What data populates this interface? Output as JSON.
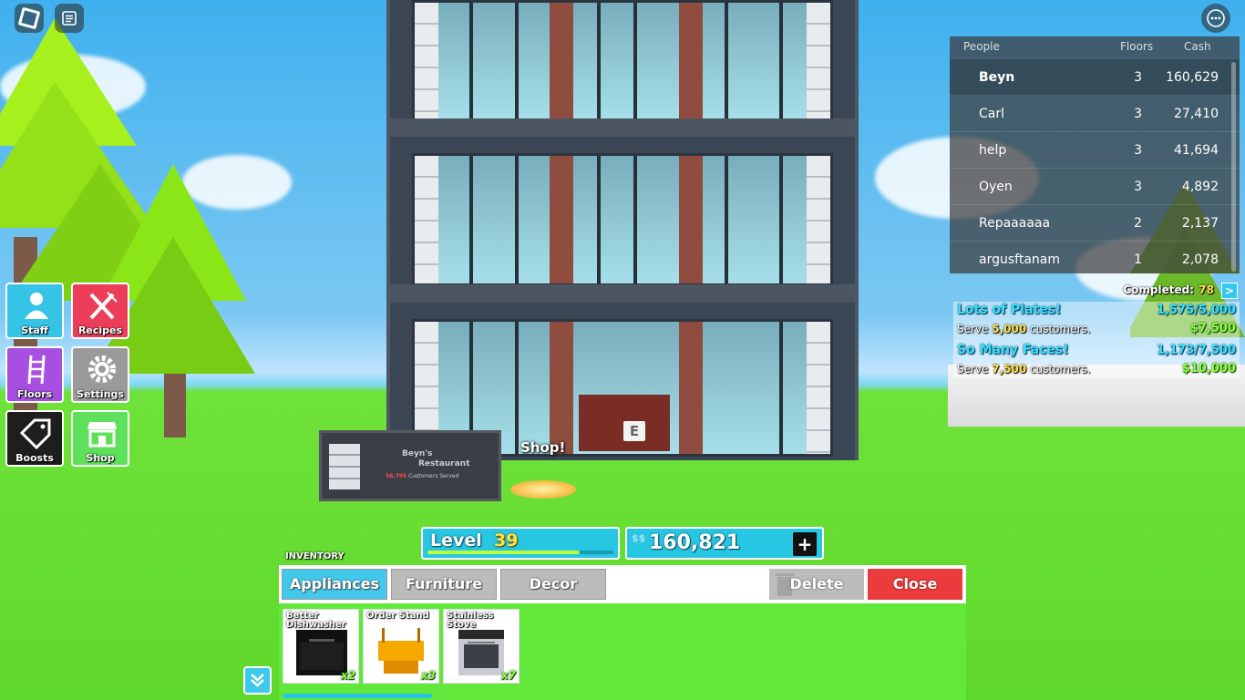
{
  "topbar": {
    "roblox_icon": "roblox-logo-icon",
    "chat_icon": "chat-icon",
    "more_icon": "more-options-icon"
  },
  "menu": {
    "staff": "Staff",
    "recipes": "Recipes",
    "floors": "Floors",
    "settings": "Settings",
    "boosts": "Boosts",
    "shop": "Shop"
  },
  "leaderboard": {
    "headers": {
      "people": "People",
      "floors": "Floors",
      "cash": "Cash"
    },
    "rows": [
      {
        "name": "Beyn",
        "floors": "3",
        "cash": "160,629"
      },
      {
        "name": "Carl",
        "floors": "3",
        "cash": "27,410"
      },
      {
        "name": "help",
        "floors": "3",
        "cash": "41,694"
      },
      {
        "name": "Oyen",
        "floors": "3",
        "cash": "4,892"
      },
      {
        "name": "Repaaaaaa",
        "floors": "2",
        "cash": "2,137"
      },
      {
        "name": "argusftanam",
        "floors": "1",
        "cash": "2,078"
      }
    ]
  },
  "quests": {
    "completed_label": "Completed:",
    "completed_count": "78",
    "expand_label": ">",
    "items": [
      {
        "title": "Lots of Plates!",
        "progress": "1,575/5,000",
        "desc_pre": "Serve ",
        "desc_num": "5,000",
        "desc_post": " customers.",
        "reward": "$7,500"
      },
      {
        "title": "So Many Faces!",
        "progress": "1,173/7,500",
        "desc_pre": "Serve ",
        "desc_num": "7,500",
        "desc_post": " customers.",
        "reward": "$10,000"
      }
    ]
  },
  "world": {
    "sign_line1": "Beyn's",
    "sign_line2": "Restaurant",
    "sign_count": "56,795",
    "sign_served": " Customers Served",
    "shop_label": "Shop!",
    "interact_key": "E"
  },
  "hud": {
    "level_label": "Level",
    "level_value": "39",
    "xp_fraction": 0.82,
    "cash_currency": "$$",
    "cash_value": "160,821",
    "cash_plus": "+"
  },
  "inventory": {
    "label": "INVENTORY",
    "tabs": [
      "Appliances",
      "Furniture",
      "Decor"
    ],
    "active_tab": "Appliances",
    "delete_label": "Delete",
    "close_label": "Close",
    "items": [
      {
        "name": "Better Dishwasher",
        "qty": "x2"
      },
      {
        "name": "Order Stand",
        "qty": "x3"
      },
      {
        "name": "Stainless Stove",
        "qty": "x7"
      }
    ]
  },
  "colors": {
    "accent": "#27c6e2",
    "close": "#ea3c3c",
    "panel_green": "#62e83a",
    "quest_title": "#33e0ff"
  }
}
